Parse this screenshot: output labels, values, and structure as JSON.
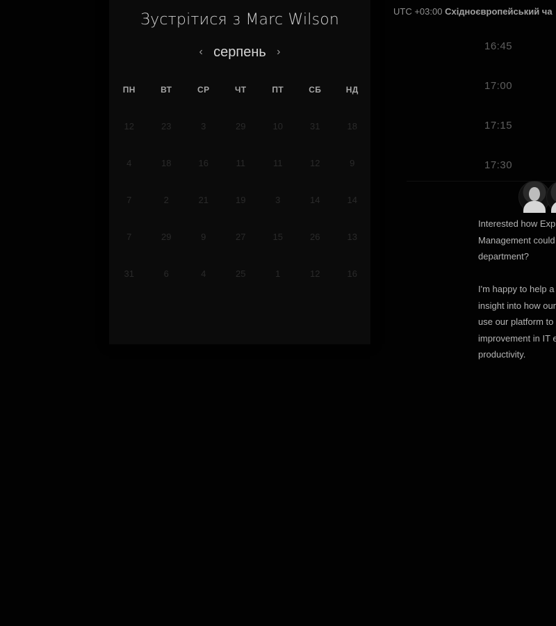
{
  "calendar": {
    "title": "Зустрітися з Marc Wilson",
    "month": "серпень",
    "prev_icon": "‹",
    "next_icon": "›",
    "weekdays": [
      "ПН",
      "ВТ",
      "СР",
      "ЧТ",
      "ПТ",
      "СБ",
      "НД"
    ],
    "weeks": [
      [
        "12",
        "23",
        "3",
        "29",
        "10",
        "31",
        "18"
      ],
      [
        "4",
        "18",
        "16",
        "11",
        "11",
        "12",
        "9"
      ],
      [
        "7",
        "2",
        "21",
        "19",
        "3",
        "14",
        "14"
      ],
      [
        "7",
        "29",
        "9",
        "27",
        "15",
        "26",
        "13"
      ],
      [
        "31",
        "6",
        "4",
        "25",
        "1",
        "12",
        "16"
      ]
    ]
  },
  "timezone": {
    "offset": "UTC +03:00",
    "name": "Східноєвропейський ча"
  },
  "time_slots": [
    "16:45",
    "17:00",
    "17:15",
    "17:30"
  ],
  "description": {
    "paragraph1": [
      "Interested how Exp",
      "Management could",
      "department?"
    ],
    "paragraph2": [
      "I'm happy to help a",
      "insight into how our",
      "use our platform to",
      "improvement in IT e",
      "productivity."
    ]
  }
}
